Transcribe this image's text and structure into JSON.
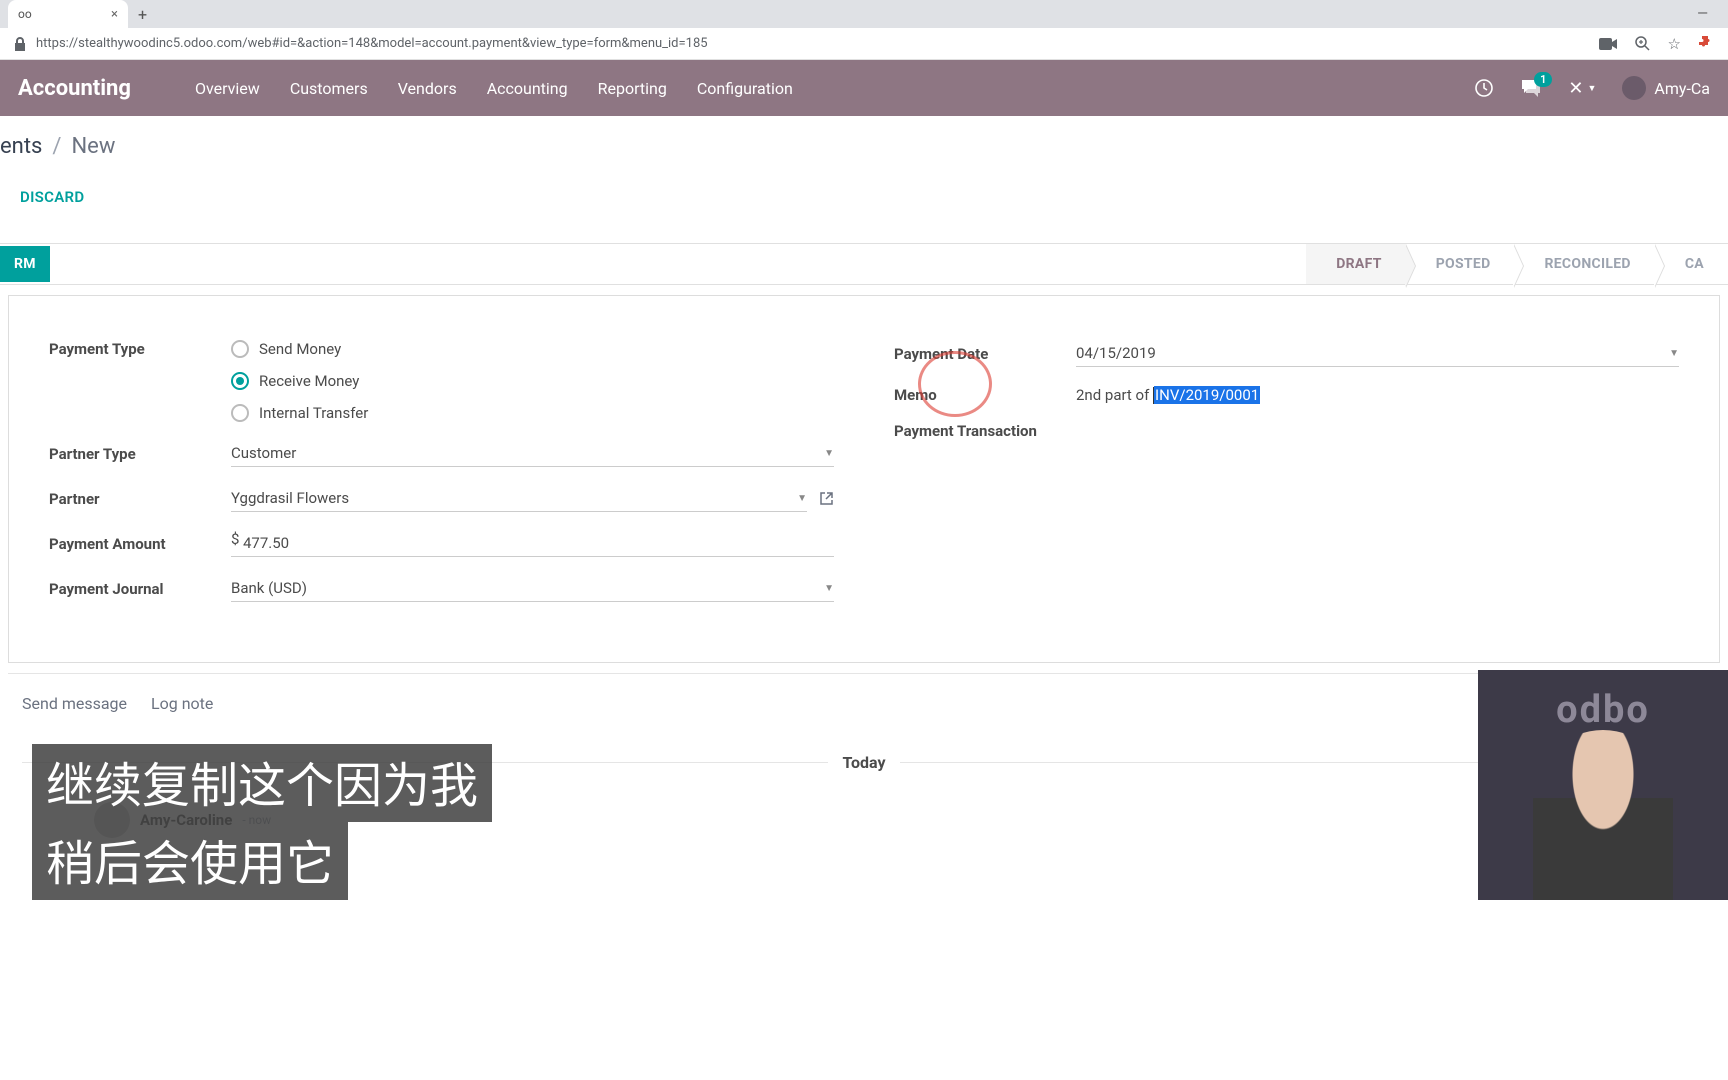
{
  "browser": {
    "tab_title": "oo",
    "url": "https://stealthywoodinc5.odoo.com/web#id=&action=148&model=account.payment&view_type=form&menu_id=185"
  },
  "header": {
    "app_name": "Accounting",
    "nav": [
      "Overview",
      "Customers",
      "Vendors",
      "Accounting",
      "Reporting",
      "Configuration"
    ],
    "msg_count": "1",
    "user_name": "Amy-Ca"
  },
  "breadcrumb": {
    "back": "ents",
    "current": "New"
  },
  "buttons": {
    "confirm": "RM",
    "discard": "DISCARD"
  },
  "status": [
    "DRAFT",
    "POSTED",
    "RECONCILED",
    "CA"
  ],
  "form": {
    "left": {
      "payment_type_label": "Payment Type",
      "send": "Send Money",
      "receive": "Receive Money",
      "internal": "Internal Transfer",
      "partner_type_label": "Partner Type",
      "partner_type_value": "Customer",
      "partner_label": "Partner",
      "partner_value": "Yggdrasil Flowers",
      "amount_label": "Payment Amount",
      "amount_currency": "$",
      "amount_value": "477.50",
      "journal_label": "Payment Journal",
      "journal_value": "Bank (USD)"
    },
    "right": {
      "date_label": "Payment Date",
      "date_value": "04/15/2019",
      "memo_label": "Memo",
      "memo_prefix": "2nd part of ",
      "memo_selected": "INV/2019/0001",
      "txn_label": "Payment Transaction"
    }
  },
  "chatter": {
    "send": "Send message",
    "lognote": "Log note",
    "today": "Today",
    "user": "Amy-Caroline",
    "sub": "- now"
  },
  "subtitle": {
    "line1": "继续复制这个因为我",
    "line2": "稍后会使用它"
  },
  "webcam_logo": "odbo"
}
